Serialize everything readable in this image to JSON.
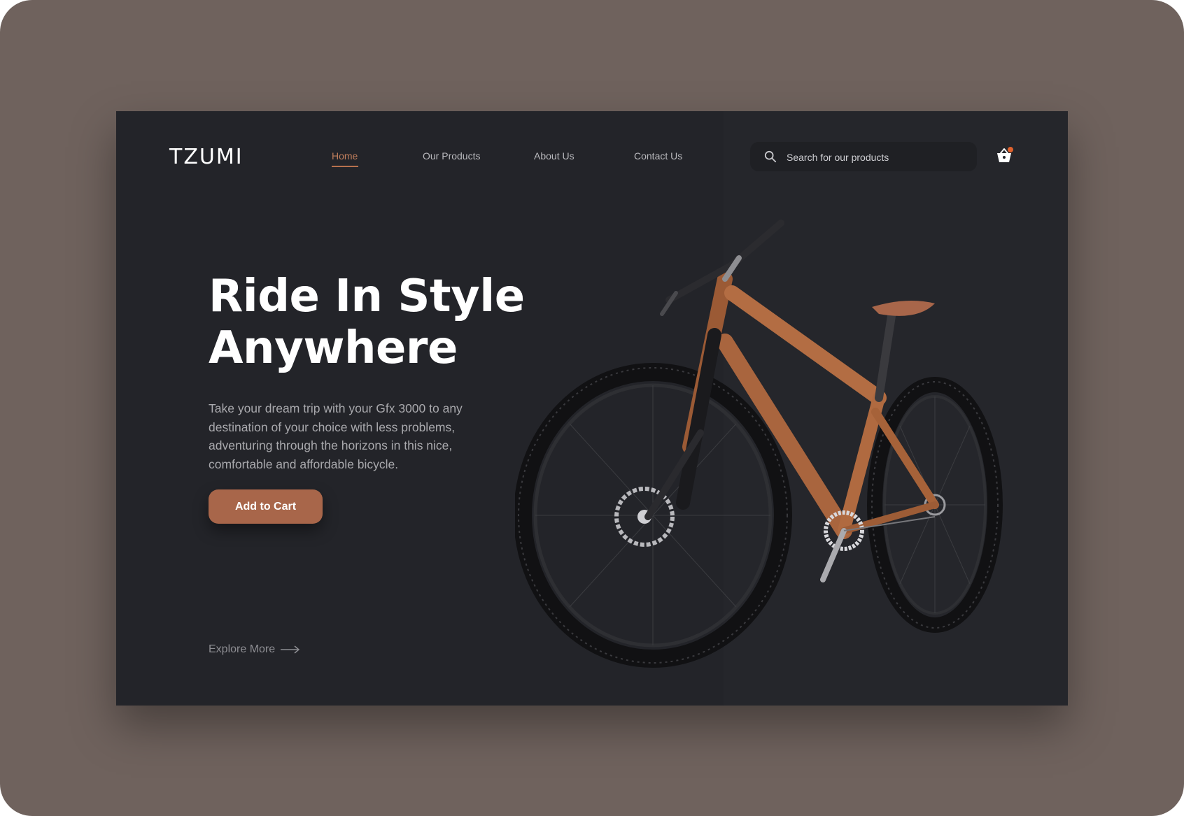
{
  "app": {
    "logo": "TZUMI"
  },
  "nav": {
    "items": [
      {
        "label": "Home",
        "active": true
      },
      {
        "label": "Our Products",
        "active": false
      },
      {
        "label": "About Us",
        "active": false
      },
      {
        "label": "Contact Us",
        "active": false
      }
    ]
  },
  "search": {
    "placeholder": "Search for our products"
  },
  "cart": {
    "has_badge": true
  },
  "hero": {
    "title_line1": "Ride In Style",
    "title_line2": "Anywhere",
    "description": "Take your dream trip with your Gfx 3000 to any destination of your choice with less problems, adventuring through the horizons in this nice, comfortable and affordable bicycle.",
    "cta_label": "Add to Cart",
    "explore_label": "Explore More"
  },
  "colors": {
    "accent": "#a8664a",
    "active_nav": "#c07e5c",
    "background": "#232429",
    "frame": "#6f625d",
    "badge": "#e0622d"
  }
}
